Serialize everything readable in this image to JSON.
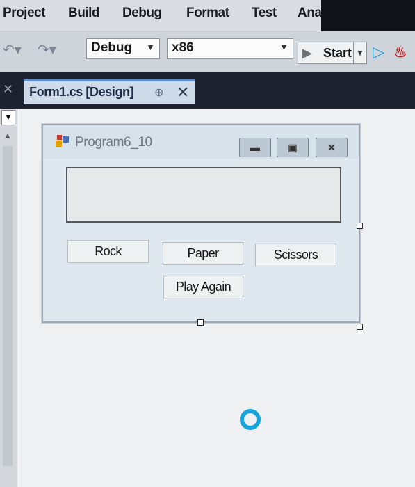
{
  "menu": {
    "items": [
      "Project",
      "Build",
      "Debug",
      "Format",
      "Test",
      "Ana"
    ]
  },
  "toolbar": {
    "configuration": "Debug",
    "platform": "x86",
    "start_label": "Start"
  },
  "document_tab": {
    "title": "Form1.cs [Design]"
  },
  "form": {
    "caption": "Program6_10",
    "textbox_value": "",
    "buttons": {
      "rock": "Rock",
      "paper": "Paper",
      "scissors": "Scissors",
      "play_again": "Play Again"
    }
  },
  "icons": {
    "undo": "undo-icon",
    "redo": "redo-icon",
    "start": "play-icon",
    "start_without_debugging": "play-outline-icon",
    "hot_reload": "flame-icon",
    "pin": "pin-icon",
    "close": "close-icon",
    "loading": "loading-spinner-icon"
  },
  "colors": {
    "tab_strip": "#1c2230",
    "accent": "#17a4db"
  }
}
